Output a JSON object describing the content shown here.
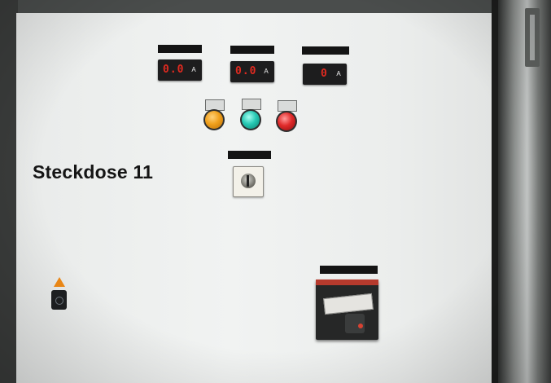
{
  "sign": {
    "text": "Steckdose 11"
  },
  "meters": [
    {
      "reading": "0.0",
      "unit": "A"
    },
    {
      "reading": "0.0",
      "unit": "A"
    },
    {
      "reading": "0",
      "unit": "A"
    }
  ]
}
